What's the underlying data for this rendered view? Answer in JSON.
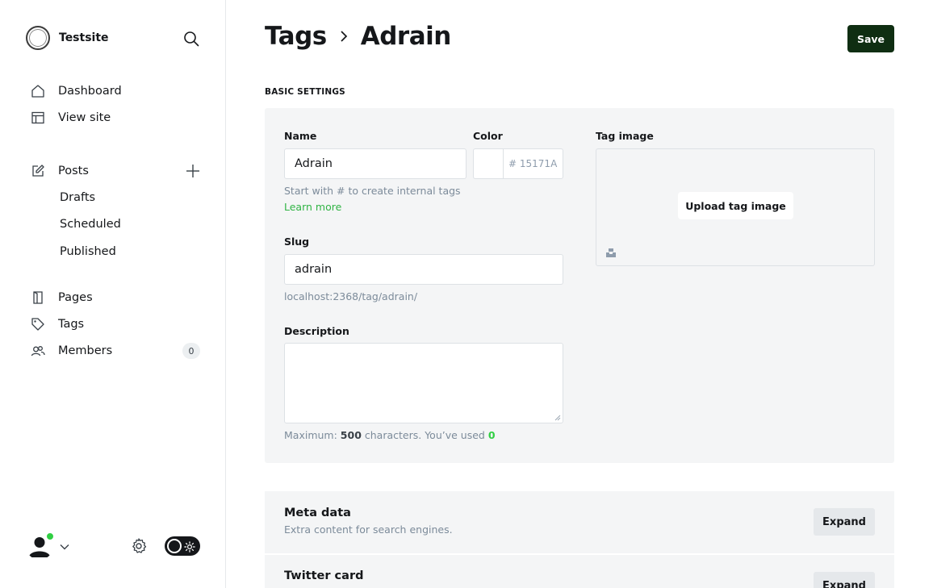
{
  "site": {
    "name": "Testsite"
  },
  "nav": {
    "dashboard": "Dashboard",
    "view_site": "View site",
    "posts": "Posts",
    "drafts": "Drafts",
    "scheduled": "Scheduled",
    "published": "Published",
    "pages": "Pages",
    "tags": "Tags",
    "members": "Members",
    "members_count": "0"
  },
  "header": {
    "breadcrumb_parent": "Tags",
    "breadcrumb_current": "Adrain",
    "save_label": "Save"
  },
  "basic_settings": {
    "heading": "BASIC SETTINGS",
    "name_label": "Name",
    "name_value": "Adrain",
    "name_hint": "Start with # to create internal tags",
    "learn_more": "Learn more",
    "color_label": "Color",
    "color_hash": "#",
    "color_placeholder": "15171A",
    "slug_label": "Slug",
    "slug_value": "adrain",
    "slug_url": "localhost:2368/tag/adrain/",
    "description_label": "Description",
    "description_value": "",
    "desc_hint_prefix": "Maximum:",
    "desc_max": "500",
    "desc_hint_mid": "characters. You’ve used",
    "desc_used": "0",
    "tag_image_label": "Tag image",
    "upload_label": "Upload tag image"
  },
  "meta_data": {
    "title": "Meta data",
    "subtitle": "Extra content for search engines.",
    "expand_label": "Expand"
  },
  "twitter_card": {
    "title": "Twitter card",
    "expand_label": "Expand"
  },
  "colors": {
    "accent_green": "#30cf43",
    "save_button": "#0f2e12",
    "panel_bg": "#f4f5f6"
  }
}
